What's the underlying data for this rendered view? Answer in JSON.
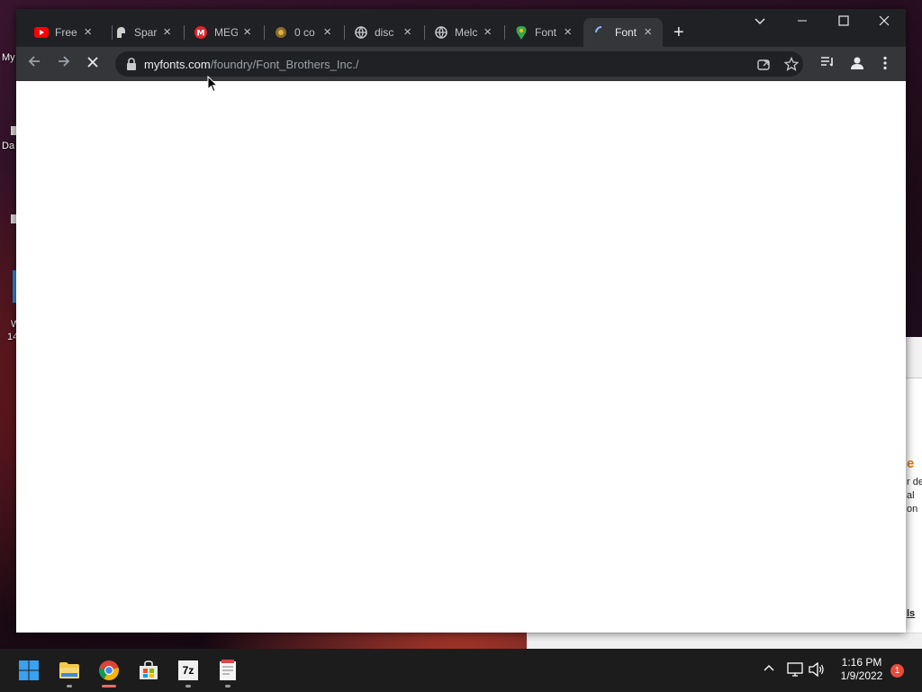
{
  "desktop": {
    "labels": [
      "My",
      "Da",
      "W",
      "14"
    ],
    "bg_window": {
      "heading": "e",
      "lines": [
        "r de",
        "al",
        "on"
      ],
      "link": "ls"
    }
  },
  "browser": {
    "tabs": [
      {
        "title": "Free",
        "icon": "youtube-icon"
      },
      {
        "title": "Spar",
        "icon": "spartan-helmet-icon"
      },
      {
        "title": "MEG",
        "icon": "mega-icon"
      },
      {
        "title": "0 co",
        "icon": "coin-icon"
      },
      {
        "title": "disc",
        "icon": "globe-icon"
      },
      {
        "title": "Melc",
        "icon": "globe-icon"
      },
      {
        "title": "Font",
        "icon": "maps-pin-icon"
      },
      {
        "title": "Font",
        "icon": "loading-spinner-icon"
      }
    ],
    "active_tab_index": 7,
    "url_host": "myfonts.com",
    "url_path": "/foundry/Font_Brothers_Inc./",
    "loading": true
  },
  "taskbar": {
    "apps": [
      "start-icon",
      "file-explorer-icon",
      "chrome-icon",
      "store-icon",
      "7zip-icon",
      "notepad-icon"
    ],
    "app_7z_label": "7z",
    "time": "1:16 PM",
    "date": "1/9/2022",
    "notification_count": "1"
  },
  "colors": {
    "tabstrip_bg": "#202124",
    "toolbar_bg": "#35363a",
    "accent_red": "#f06a6a"
  }
}
